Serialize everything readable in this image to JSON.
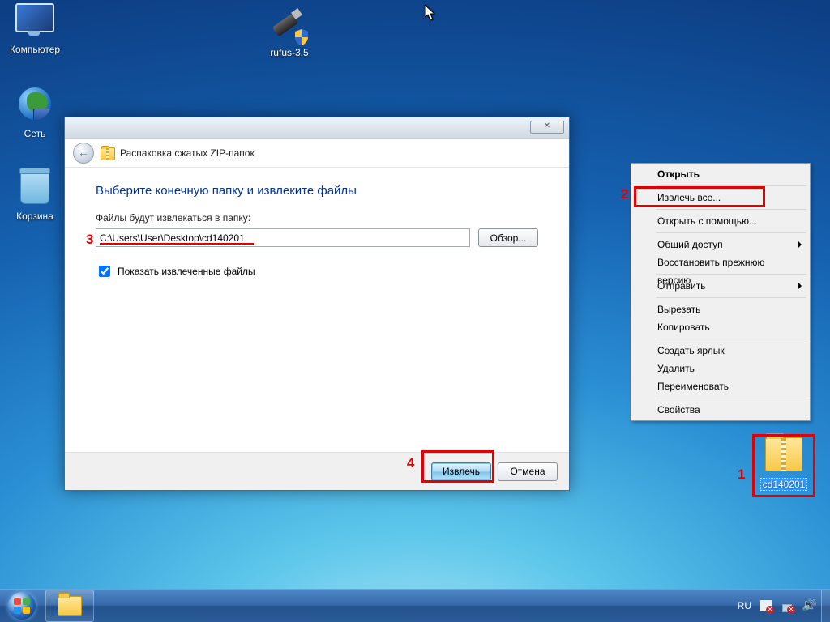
{
  "desktop": {
    "icons": {
      "computer": "Компьютер",
      "network": "Сеть",
      "recycle": "Корзина",
      "rufus": "rufus-3.5",
      "zipfile": "cd140201"
    }
  },
  "wizard": {
    "close_glyph": "✕",
    "back_glyph": "←",
    "header": "Распаковка сжатых ZIP-папок",
    "title": "Выберите конечную папку и извлеките файлы",
    "dest_label": "Файлы будут извлекаться в папку:",
    "dest_value": "C:\\Users\\User\\Desktop\\cd140201",
    "browse": "Обзор...",
    "show_checked": true,
    "show_label": "Показать извлеченные файлы",
    "extract": "Извлечь",
    "cancel": "Отмена"
  },
  "context_menu": {
    "open": "Открыть",
    "extract_all": "Извлечь все...",
    "open_with": "Открыть с помощью...",
    "share": "Общий доступ",
    "restore": "Восстановить прежнюю версию",
    "send_to": "Отправить",
    "cut": "Вырезать",
    "copy": "Копировать",
    "shortcut": "Создать ярлык",
    "delete": "Удалить",
    "rename": "Переименовать",
    "properties": "Свойства"
  },
  "annotations": {
    "n1": "1",
    "n2": "2",
    "n3": "3",
    "n4": "4"
  },
  "taskbar": {
    "lang": "RU"
  }
}
